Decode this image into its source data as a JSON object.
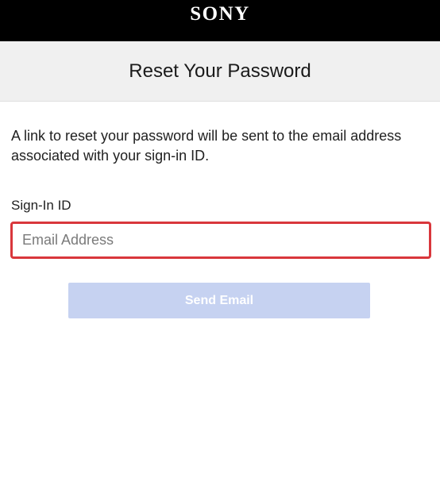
{
  "header": {
    "logo_text": "SONY"
  },
  "page": {
    "title": "Reset Your Password",
    "description": "A link to reset your password will be sent to the email address associated with your sign-in ID."
  },
  "form": {
    "field_label": "Sign-In ID",
    "email_placeholder": "Email Address",
    "email_value": "",
    "submit_label": "Send Email",
    "submit_disabled": true
  },
  "colors": {
    "header_bg": "#000000",
    "title_band_bg": "#f0f0f0",
    "input_border_error": "#d9373c",
    "button_disabled_bg": "#c6d2f1"
  }
}
